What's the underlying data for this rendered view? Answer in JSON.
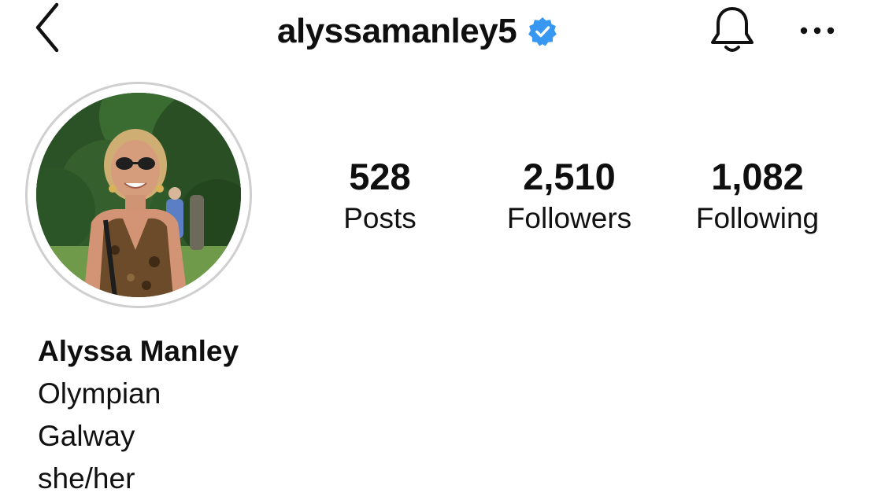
{
  "header": {
    "username": "alyssamanley5",
    "verified": true,
    "back_icon": "chevron-left-icon",
    "verified_icon": "verified-badge-icon",
    "bell_icon": "bell-icon",
    "more_icon": "more-horizontal-icon"
  },
  "profile": {
    "avatar_description_icon": "profile-photo",
    "stats": [
      {
        "value": "528",
        "label": "Posts"
      },
      {
        "value": "2,510",
        "label": "Followers"
      },
      {
        "value": "1,082",
        "label": "Following"
      }
    ],
    "name": "Alyssa Manley",
    "bio_lines": [
      "Olympian",
      "Galway",
      "she/her"
    ]
  },
  "colors": {
    "verified_blue": "#3897f0",
    "text": "#111111",
    "ring": "#cfcfcf",
    "background": "#ffffff"
  }
}
